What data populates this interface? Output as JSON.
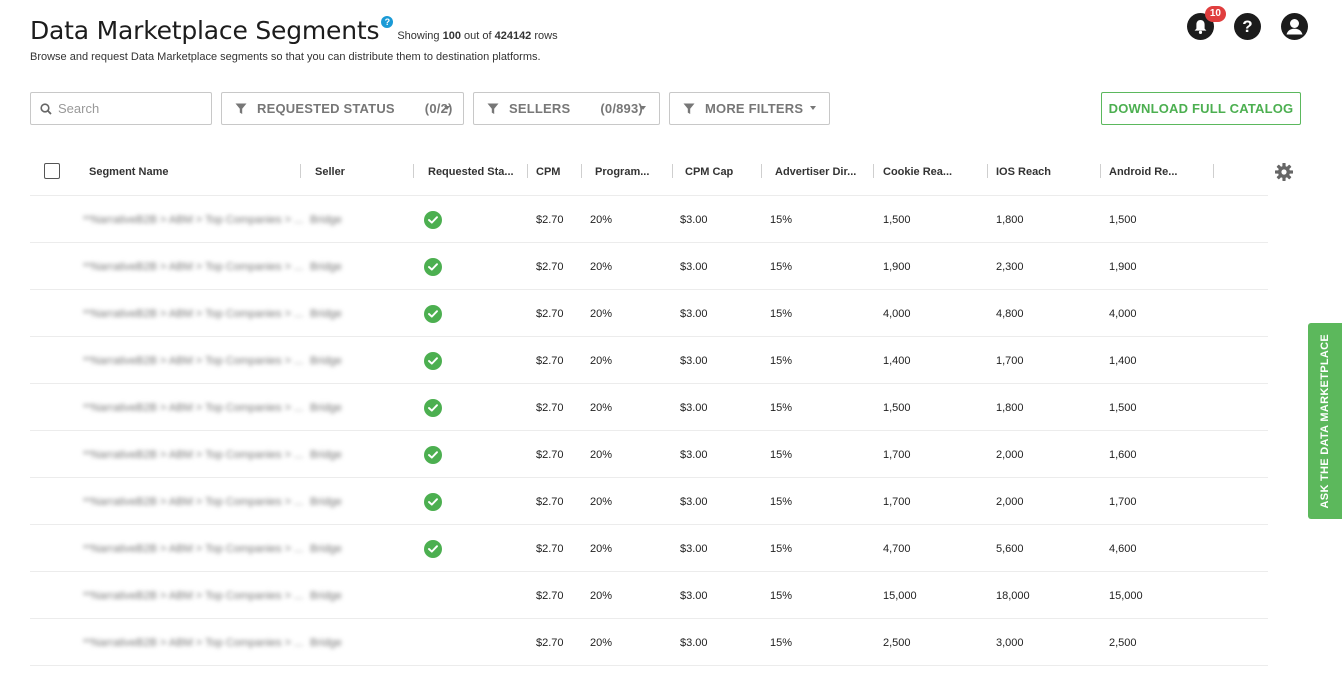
{
  "header": {
    "title": "Data Marketplace Segments",
    "help_symbol": "?",
    "showing_prefix": "Showing",
    "showing_count": "100",
    "showing_mid": "out of",
    "total_rows": "424142",
    "showing_suffix": "rows",
    "subtitle": "Browse and request Data Marketplace segments so that you can distribute them to destination platforms."
  },
  "top_icons": {
    "notification_count": "10",
    "help_symbol": "?"
  },
  "filters": {
    "search_placeholder": "Search",
    "requested_status": {
      "label": "REQUESTED STATUS",
      "count": "(0/2)"
    },
    "sellers": {
      "label": "SELLERS",
      "count": "(0/893)"
    },
    "more_filters": {
      "label": "MORE FILTERS"
    },
    "download_label": "DOWNLOAD FULL CATALOG"
  },
  "table": {
    "columns": [
      "Segment Name",
      "Seller",
      "Requested Sta...",
      "CPM",
      "Program...",
      "CPM Cap",
      "Advertiser Dir...",
      "Cookie Rea...",
      "IOS Reach",
      "Android Re..."
    ],
    "rows": [
      {
        "segment": "**NarrativeB2B > ABM > Top Companies > ...",
        "seller": "Bridge",
        "requested": true,
        "cpm": "$2.70",
        "program": "20%",
        "cpm_cap": "$3.00",
        "advertiser": "15%",
        "cookie": "1,500",
        "ios": "1,800",
        "android": "1,500"
      },
      {
        "segment": "**NarrativeB2B > ABM > Top Companies > ...",
        "seller": "Bridge",
        "requested": true,
        "cpm": "$2.70",
        "program": "20%",
        "cpm_cap": "$3.00",
        "advertiser": "15%",
        "cookie": "1,900",
        "ios": "2,300",
        "android": "1,900"
      },
      {
        "segment": "**NarrativeB2B > ABM > Top Companies > ...",
        "seller": "Bridge",
        "requested": true,
        "cpm": "$2.70",
        "program": "20%",
        "cpm_cap": "$3.00",
        "advertiser": "15%",
        "cookie": "4,000",
        "ios": "4,800",
        "android": "4,000"
      },
      {
        "segment": "**NarrativeB2B > ABM > Top Companies > ...",
        "seller": "Bridge",
        "requested": true,
        "cpm": "$2.70",
        "program": "20%",
        "cpm_cap": "$3.00",
        "advertiser": "15%",
        "cookie": "1,400",
        "ios": "1,700",
        "android": "1,400"
      },
      {
        "segment": "**NarrativeB2B > ABM > Top Companies > ...",
        "seller": "Bridge",
        "requested": true,
        "cpm": "$2.70",
        "program": "20%",
        "cpm_cap": "$3.00",
        "advertiser": "15%",
        "cookie": "1,500",
        "ios": "1,800",
        "android": "1,500"
      },
      {
        "segment": "**NarrativeB2B > ABM > Top Companies > ...",
        "seller": "Bridge",
        "requested": true,
        "cpm": "$2.70",
        "program": "20%",
        "cpm_cap": "$3.00",
        "advertiser": "15%",
        "cookie": "1,700",
        "ios": "2,000",
        "android": "1,600"
      },
      {
        "segment": "**NarrativeB2B > ABM > Top Companies > ...",
        "seller": "Bridge",
        "requested": true,
        "cpm": "$2.70",
        "program": "20%",
        "cpm_cap": "$3.00",
        "advertiser": "15%",
        "cookie": "1,700",
        "ios": "2,000",
        "android": "1,700"
      },
      {
        "segment": "**NarrativeB2B > ABM > Top Companies > ...",
        "seller": "Bridge",
        "requested": true,
        "cpm": "$2.70",
        "program": "20%",
        "cpm_cap": "$3.00",
        "advertiser": "15%",
        "cookie": "4,700",
        "ios": "5,600",
        "android": "4,600"
      },
      {
        "segment": "**NarrativeB2B > ABM > Top Companies > ...",
        "seller": "Bridge",
        "requested": false,
        "cpm": "$2.70",
        "program": "20%",
        "cpm_cap": "$3.00",
        "advertiser": "15%",
        "cookie": "15,000",
        "ios": "18,000",
        "android": "15,000"
      },
      {
        "segment": "**NarrativeB2B > ABM > Top Companies > ...",
        "seller": "Bridge",
        "requested": false,
        "cpm": "$2.70",
        "program": "20%",
        "cpm_cap": "$3.00",
        "advertiser": "15%",
        "cookie": "2,500",
        "ios": "3,000",
        "android": "2,500"
      }
    ]
  },
  "side_tab": {
    "label": "ASK THE DATA MARKETPLACE"
  },
  "colors": {
    "accent_green": "#4caf50",
    "badge_red": "#e03e3e",
    "help_blue": "#1a9ad6"
  }
}
